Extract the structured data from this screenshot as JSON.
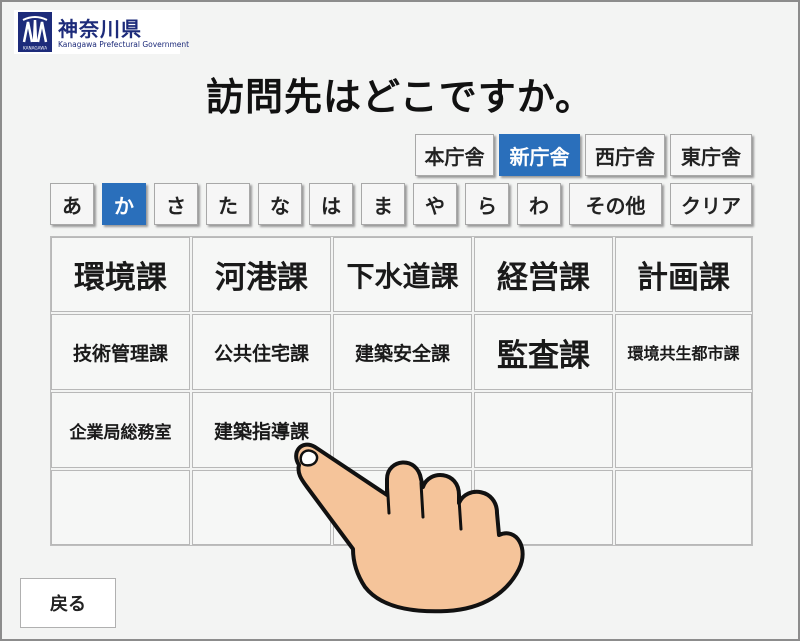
{
  "logo": {
    "title": "神奈川県",
    "subtitle": "Kanagawa Prefectural Government",
    "mark_text": "KANAGAWA",
    "color": "#1d2b7a"
  },
  "page_title": "訪問先はどこですか。",
  "buildings": [
    {
      "label": "本庁舎",
      "selected": false
    },
    {
      "label": "新庁舎",
      "selected": true
    },
    {
      "label": "西庁舎",
      "selected": false
    },
    {
      "label": "東庁舎",
      "selected": false
    }
  ],
  "kana": [
    {
      "label": "あ",
      "selected": false
    },
    {
      "label": "か",
      "selected": true
    },
    {
      "label": "さ",
      "selected": false
    },
    {
      "label": "た",
      "selected": false
    },
    {
      "label": "な",
      "selected": false
    },
    {
      "label": "は",
      "selected": false
    },
    {
      "label": "ま",
      "selected": false
    },
    {
      "label": "や",
      "selected": false
    },
    {
      "label": "ら",
      "selected": false
    },
    {
      "label": "わ",
      "selected": false
    },
    {
      "label": "その他",
      "selected": false
    },
    {
      "label": "クリア",
      "selected": false
    }
  ],
  "departments": [
    "環境課",
    "河港課",
    "下水道課",
    "経営課",
    "計画課",
    "技術管理課",
    "公共住宅課",
    "建築安全課",
    "監査課",
    "環境共生都市課",
    "企業局総務室",
    "建築指導課",
    "",
    "",
    "",
    "",
    "",
    "",
    "",
    ""
  ],
  "back_label": "戻る",
  "colors": {
    "accent": "#2a6fbb",
    "hand": "#f5c49a",
    "frame": "#8c8c8c"
  },
  "icons": {
    "pointer": "pointing-hand-icon",
    "logo": "kanagawa-logo-icon"
  }
}
